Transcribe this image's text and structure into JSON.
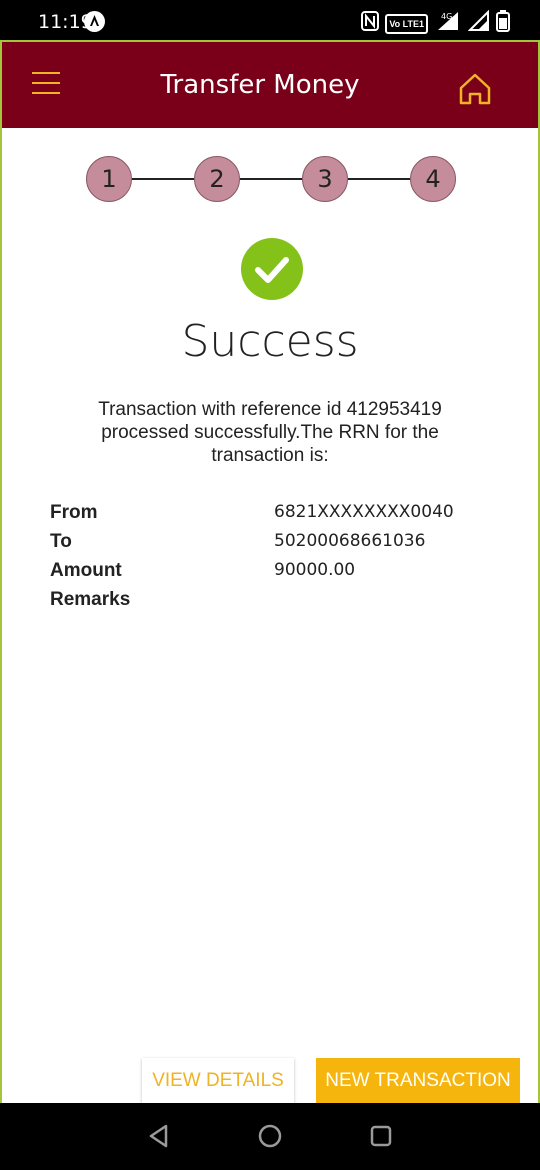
{
  "status_bar": {
    "time": "11:19",
    "icons": [
      "assistant-icon",
      "nfc-icon",
      "volte-icon",
      "4g-signal-icon",
      "roaming-signal-icon",
      "battery-icon"
    ],
    "volte_label": "Vo LTE1",
    "net_label": "4G"
  },
  "header": {
    "title": "Transfer Money",
    "accent_color": "#f0b323",
    "background_color": "#7a0019"
  },
  "steps": [
    "1",
    "2",
    "3",
    "4"
  ],
  "result": {
    "title": "Success",
    "message": "Transaction with reference id 412953419 processed successfully.The RRN for the transaction is:"
  },
  "details": [
    {
      "label": "From",
      "value": "6821XXXXXXXX0040"
    },
    {
      "label": "To",
      "value": "50200068661036"
    },
    {
      "label": "Amount",
      "value": "90000.00"
    },
    {
      "label": "Remarks",
      "value": ""
    }
  ],
  "buttons": {
    "view_details": "VIEW DETAILS",
    "new_transaction": "NEW TRANSACTION"
  },
  "nav": [
    "back-icon",
    "home-circle-icon",
    "recents-icon"
  ]
}
